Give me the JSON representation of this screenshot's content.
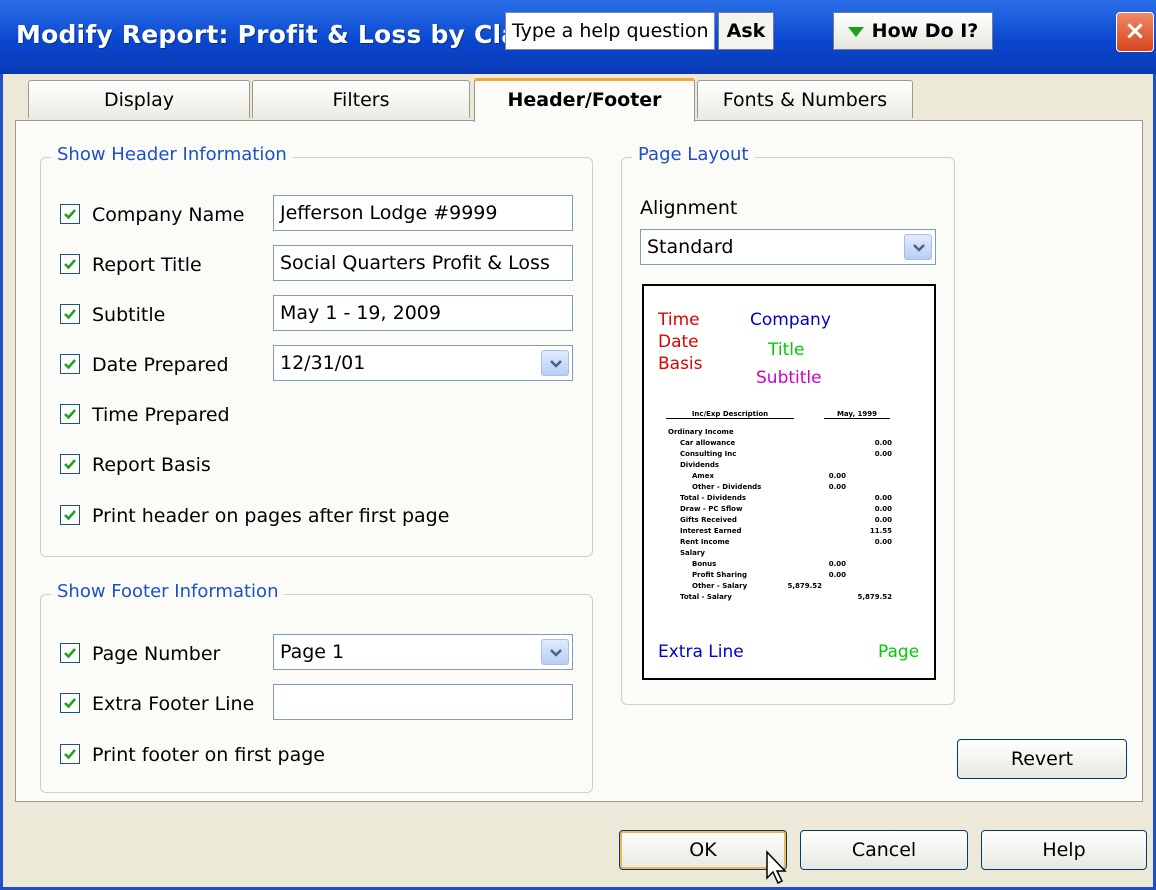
{
  "window": {
    "title": "Modify Report: Profit & Loss by Class",
    "help_placeholder": "Type a help question",
    "ask_label": "Ask",
    "howdoi_label": "How Do I?",
    "close_glyph": "×"
  },
  "tabs": [
    {
      "label": "Display"
    },
    {
      "label": "Filters"
    },
    {
      "label": "Header/Footer",
      "active": true
    },
    {
      "label": "Fonts & Numbers"
    }
  ],
  "header_group": {
    "legend": "Show Header Information",
    "company_name": {
      "label": "Company Name",
      "checked": true,
      "value": "Jefferson Lodge #9999"
    },
    "report_title": {
      "label": "Report Title",
      "checked": true,
      "value": "Social Quarters Profit & Loss"
    },
    "subtitle": {
      "label": "Subtitle",
      "checked": true,
      "value": "May 1 - 19, 2009"
    },
    "date_prepared": {
      "label": "Date Prepared",
      "checked": true,
      "value": "12/31/01"
    },
    "time_prepared": {
      "label": "Time Prepared",
      "checked": true
    },
    "report_basis": {
      "label": "Report Basis",
      "checked": true
    },
    "print_header": {
      "label": "Print header on pages after first page",
      "checked": true
    }
  },
  "footer_group": {
    "legend": "Show Footer Information",
    "page_number": {
      "label": "Page Number",
      "checked": true,
      "value": "Page 1"
    },
    "extra_footer": {
      "label": "Extra Footer Line",
      "checked": true,
      "value": ""
    },
    "print_footer": {
      "label": "Print footer on first page",
      "checked": true
    }
  },
  "page_layout": {
    "legend": "Page Layout",
    "alignment_label": "Alignment",
    "alignment_value": "Standard",
    "preview": {
      "time": "Time",
      "date": "Date",
      "basis": "Basis",
      "company": "Company",
      "title": "Title",
      "subtitle": "Subtitle",
      "extra_line": "Extra Line",
      "page": "Page",
      "col_head_left": "Inc/Exp Description",
      "col_head_right": "May, 1999",
      "lines": [
        {
          "text": "Ordinary Income",
          "value": ""
        },
        {
          "text": "Car allowance",
          "value": "0.00"
        },
        {
          "text": "Consulting Inc",
          "value": "0.00"
        },
        {
          "text": "Dividends",
          "value": ""
        },
        {
          "text": "Amex",
          "value": "0.00"
        },
        {
          "text": "Other - Dividends",
          "value": "0.00"
        },
        {
          "text": "Total - Dividends",
          "value": "0.00"
        },
        {
          "text": "Draw - PC Sflow",
          "value": "0.00"
        },
        {
          "text": "Gifts Received",
          "value": "0.00"
        },
        {
          "text": "Interest Earned",
          "value": "11.55"
        },
        {
          "text": "Rent Income",
          "value": "0.00"
        },
        {
          "text": "Salary",
          "value": ""
        },
        {
          "text": "Bonus",
          "value": "0.00"
        },
        {
          "text": "Profit Sharing",
          "value": "0.00"
        },
        {
          "text": "Other - Salary",
          "value": "5,879.52"
        },
        {
          "text": "Total - Salary",
          "value": "5,879.52"
        }
      ]
    },
    "colors": {
      "time_date_basis": "#e00000",
      "company": "#0000cc",
      "title": "#00cc00",
      "subtitle": "#cc00cc",
      "extra_line": "#0000cc",
      "page": "#00cc00"
    }
  },
  "buttons": {
    "revert": "Revert",
    "ok": "OK",
    "cancel": "Cancel",
    "help": "Help"
  }
}
